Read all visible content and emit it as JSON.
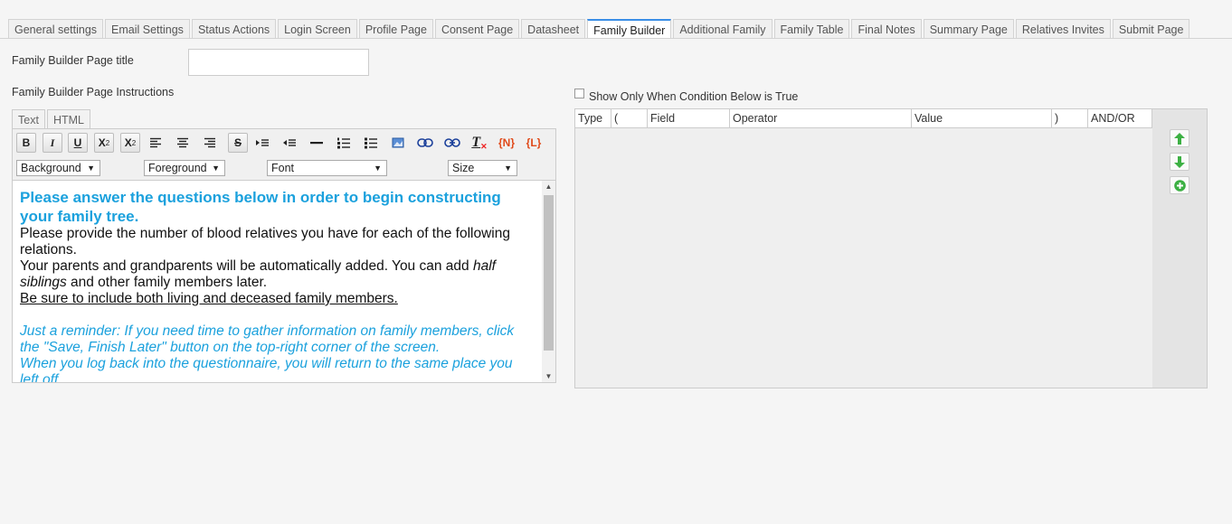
{
  "tabs": [
    {
      "label": "General settings"
    },
    {
      "label": "Email Settings"
    },
    {
      "label": "Status Actions"
    },
    {
      "label": "Login Screen"
    },
    {
      "label": "Profile Page"
    },
    {
      "label": "Consent Page"
    },
    {
      "label": "Datasheet"
    },
    {
      "label": "Family Builder",
      "active": true
    },
    {
      "label": "Additional Family"
    },
    {
      "label": "Family Table"
    },
    {
      "label": "Final Notes"
    },
    {
      "label": "Summary Page"
    },
    {
      "label": "Relatives Invites"
    },
    {
      "label": "Submit Page"
    }
  ],
  "form": {
    "title_label": "Family Builder Page title",
    "title_value": "",
    "instructions_label": "Family Builder Page Instructions"
  },
  "editor": {
    "mode_tabs": [
      "Text",
      "HTML"
    ],
    "toolbar": {
      "bold": "B",
      "italic": "I",
      "underline": "U",
      "subscript": "X",
      "sub_mark": "2",
      "superscript": "X",
      "sup_mark": "2",
      "strike": "S",
      "remove_format": "T",
      "name_token": "{N}",
      "link_token": "{L}",
      "background": "Background",
      "foreground": "Foreground",
      "font": "Font",
      "size": "Size"
    },
    "content": {
      "heading": "Please answer the questions below in order to begin constructing your family tree.",
      "line1": "Please provide the number of blood relatives you have for each of the following relations.",
      "line2_a": "Your parents and grandparents will be automatically added. You can add ",
      "line2_italic": "half siblings",
      "line2_b": " and other family members later.",
      "line3": "Be sure to include both living and deceased family members.",
      "reminder1": "Just a reminder: If you need time to gather information on family members, click the \"Save, Finish Later\" button on the top-right corner of the screen.",
      "reminder2": "When you log back into the questionnaire, you will return to the same place you left off."
    }
  },
  "condition": {
    "checkbox_label": "Show Only When Condition Below is True",
    "checked": false,
    "columns": [
      "Type",
      "(",
      "Field",
      "Operator",
      "Value",
      ")",
      "AND/OR"
    ]
  },
  "icons": {
    "move_up": "arrow-up-icon",
    "move_down": "arrow-down-icon",
    "add": "plus-circle-icon"
  },
  "colors": {
    "accent": "#1ba1dd",
    "active_tab": "#3a8ee6",
    "green_button": "#3cb043",
    "token_red": "#e04a1a"
  }
}
